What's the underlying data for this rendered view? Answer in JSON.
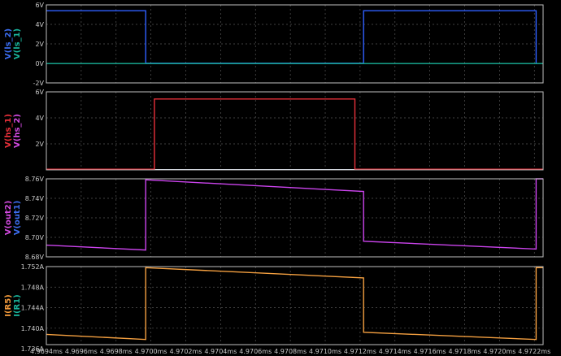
{
  "chart_data": {
    "type": "line",
    "x_unit": "ms",
    "x_range": [
      4.9694,
      4.97225
    ],
    "x_ticks": [
      "4.9694ms",
      "4.9696ms",
      "4.9698ms",
      "4.9700ms",
      "4.9702ms",
      "4.9704ms",
      "4.9706ms",
      "4.9708ms",
      "4.9710ms",
      "4.9712ms",
      "4.9714ms",
      "4.9716ms",
      "4.9718ms",
      "4.9720ms",
      "4.9722ms"
    ],
    "x_tick_values": [
      4.9694,
      4.9696,
      4.9698,
      4.97,
      4.9702,
      4.9704,
      4.9706,
      4.9708,
      4.971,
      4.9712,
      4.9714,
      4.9716,
      4.9718,
      4.972,
      4.9722
    ],
    "grid": true,
    "panes": [
      {
        "ylim": [
          -2,
          6
        ],
        "y_ticks": [
          "6V",
          "4V",
          "2V",
          "0V",
          "-2V"
        ],
        "y_tick_values": [
          6,
          4,
          2,
          0,
          -2
        ],
        "labels": [
          {
            "text": "V(ls_2)",
            "color": "#3b6df0"
          },
          {
            "text": "V(ls_1)",
            "color": "#19b39a"
          }
        ],
        "series": [
          {
            "name": "V(ls_2)",
            "color": "#2f5fff",
            "x": [
              4.9694,
              4.96997,
              4.96997,
              4.97122,
              4.97122,
              4.97221,
              4.97221
            ],
            "y": [
              5.4,
              5.4,
              0.02,
              0.02,
              5.4,
              5.4,
              0.02
            ]
          },
          {
            "name": "V(ls_1)",
            "color": "#19b39a",
            "x": [
              4.9694,
              4.97225
            ],
            "y": [
              -0.02,
              -0.02
            ]
          }
        ]
      },
      {
        "ylim": [
          0,
          6
        ],
        "y_ticks": [
          "6V",
          "4V",
          "2V"
        ],
        "y_tick_values": [
          6,
          4,
          2
        ],
        "labels": [
          {
            "text": "V(hs_1)",
            "color": "#e8303a"
          },
          {
            "text": "V(hs_2)",
            "color": "#d24ae0"
          }
        ],
        "series": [
          {
            "name": "V(hs_2)",
            "color": "#e8f0ff",
            "x": [
              4.9694,
              4.97225
            ],
            "y": [
              0.02,
              0.02
            ]
          },
          {
            "name": "V(hs_1)",
            "color": "#e8303a",
            "x": [
              4.9694,
              4.97002,
              4.97002,
              4.97117,
              4.97117,
              4.97225
            ],
            "y": [
              0.05,
              0.05,
              5.45,
              5.45,
              0.05,
              0.05
            ]
          }
        ]
      },
      {
        "ylim": [
          8.68,
          8.76
        ],
        "y_ticks": [
          "8.76V",
          "8.74V",
          "8.72V",
          "8.70V",
          "8.68V"
        ],
        "y_tick_values": [
          8.76,
          8.74,
          8.72,
          8.7,
          8.68
        ],
        "labels": [
          {
            "text": "V(out2)",
            "color": "#d24ae0"
          },
          {
            "text": "V(out1)",
            "color": "#3b6df0"
          }
        ],
        "series": [
          {
            "name": "V(out2)",
            "color": "#cc44ee",
            "x": [
              4.9694,
              4.96997,
              4.96997,
              4.97122,
              4.97122,
              4.97221,
              4.97221,
              4.97225
            ],
            "y": [
              8.692,
              8.687,
              8.759,
              8.747,
              8.696,
              8.688,
              8.76,
              8.76
            ]
          }
        ]
      },
      {
        "ylim": [
          1.7368,
          1.752
        ],
        "y_ticks": [
          "1.752A",
          "1.748A",
          "1.744A",
          "1.740A",
          "1.736A"
        ],
        "y_tick_values": [
          1.752,
          1.748,
          1.744,
          1.74,
          1.736
        ],
        "labels": [
          {
            "text": "I(R5)",
            "color": "#f29a3c"
          },
          {
            "text": "I(R1)",
            "color": "#19b39a"
          }
        ],
        "series": [
          {
            "name": "I(R5)",
            "color": "#f5a040",
            "x": [
              4.9694,
              4.96997,
              4.96997,
              4.97122,
              4.97122,
              4.97221,
              4.97221,
              4.97225
            ],
            "y": [
              1.7388,
              1.7378,
              1.7518,
              1.7498,
              1.7392,
              1.7378,
              1.7518,
              1.7518
            ]
          }
        ]
      }
    ]
  }
}
